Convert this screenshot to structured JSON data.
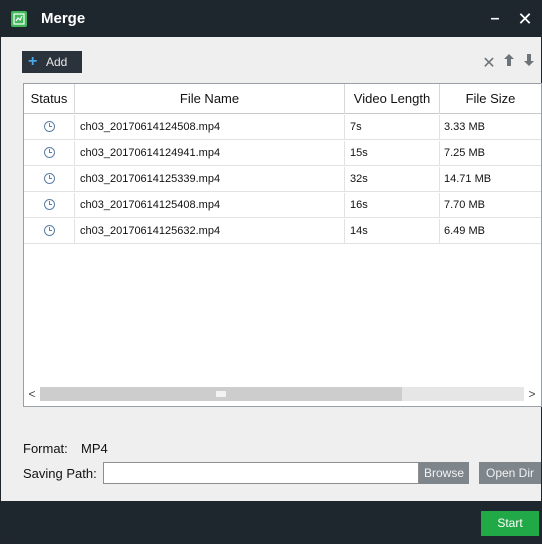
{
  "window": {
    "title": "Merge",
    "minimize_glyph": "–",
    "close_glyph": "✕"
  },
  "toolbar": {
    "add_label": "Add",
    "remove_glyph": "✕",
    "up_glyph": "🡅",
    "down_glyph": "🡇"
  },
  "table": {
    "headers": [
      "Status",
      "File Name",
      "Video Length",
      "File Size"
    ],
    "rows": [
      {
        "name": "ch03_20170614124508.mp4",
        "length": "7s",
        "size": "3.33 MB"
      },
      {
        "name": "ch03_20170614124941.mp4",
        "length": "15s",
        "size": "7.25 MB"
      },
      {
        "name": "ch03_20170614125339.mp4",
        "length": "32s",
        "size": "14.71 MB"
      },
      {
        "name": "ch03_20170614125408.mp4",
        "length": "16s",
        "size": "7.70 MB"
      },
      {
        "name": "ch03_20170614125632.mp4",
        "length": "14s",
        "size": "6.49 MB"
      }
    ],
    "scroll_left_glyph": "<",
    "scroll_right_glyph": ">"
  },
  "settings": {
    "format_label": "Format:",
    "format_value": "MP4",
    "saving_path_label": "Saving Path:",
    "saving_path_value": "",
    "browse_label": "Browse",
    "open_dir_label": "Open Dir"
  },
  "footer": {
    "start_label": "Start"
  },
  "colors": {
    "titlebar": "#1f272e",
    "start_button": "#22a947",
    "add_plus": "#4aa7e8",
    "app_icon": "#3fb85a"
  },
  "icons": {
    "app": "merge-app-icon",
    "status": "clock-icon",
    "remove": "remove-icon",
    "up": "arrow-up-icon",
    "down": "arrow-down-icon"
  }
}
